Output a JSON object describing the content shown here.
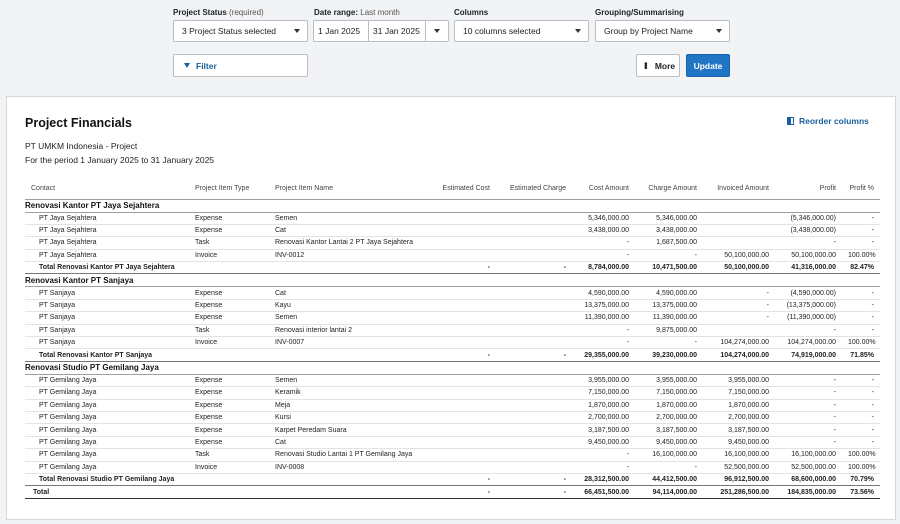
{
  "filters": {
    "status": {
      "label": "Project Status",
      "sub": "(required)",
      "value": "3 Project Status selected"
    },
    "date": {
      "label": "Date range:",
      "sub": "Last month",
      "from": "1 Jan 2025",
      "to": "31 Jan 2025"
    },
    "columns": {
      "label": "Columns",
      "value": "10 columns selected"
    },
    "grouping": {
      "label": "Grouping/Summarising",
      "value": "Group by Project Name"
    },
    "filter_label": "Filter",
    "more_label": "More",
    "update_label": "Update"
  },
  "report": {
    "title": "Project Financials",
    "org": "PT UMKM Indonesia - Project",
    "period": "For the period 1 January 2025 to 31 January 2025",
    "reorder_label": "Reorder columns",
    "headers": [
      "Contact",
      "Project Item Type",
      "Project Item Name",
      "Estimated Cost",
      "Estimated Charge",
      "Cost Amount",
      "Charge Amount",
      "Invoiced Amount",
      "Profit",
      "Profit %"
    ],
    "groups": [
      {
        "name": "Renovasi Kantor PT Jaya Sejahtera",
        "rows": [
          [
            "PT Jaya Sejahtera",
            "Expense",
            "Semen",
            "",
            "",
            "5,346,000.00",
            "5,346,000.00",
            "",
            "(5,346,000.00)",
            "-"
          ],
          [
            "PT Jaya Sejahtera",
            "Expense",
            "Cat",
            "",
            "",
            "3,438,000.00",
            "3,438,000.00",
            "",
            "(3,438,000.00)",
            "-"
          ],
          [
            "PT Jaya Sejahtera",
            "Task",
            "Renovasi Kantor Lantai 2 PT Jaya Sejahtera",
            "",
            "",
            "-",
            "1,687,500.00",
            "",
            "-",
            "-"
          ],
          [
            "PT Jaya Sejahtera",
            "Invoice",
            "INV-0012",
            "",
            "",
            "-",
            "-",
            "50,100,000.00",
            "50,100,000.00",
            "100.00%"
          ]
        ],
        "total": [
          "Total Renovasi Kantor PT Jaya Sejahtera",
          "",
          "",
          "-",
          "-",
          "8,784,000.00",
          "10,471,500.00",
          "50,100,000.00",
          "41,316,000.00",
          "82.47%"
        ]
      },
      {
        "name": "Renovasi Kantor PT Sanjaya",
        "rows": [
          [
            "PT Sanjaya",
            "Expense",
            "Cat",
            "",
            "",
            "4,590,000.00",
            "4,590,000.00",
            "-",
            "(4,590,000.00)",
            "-"
          ],
          [
            "PT Sanjaya",
            "Expense",
            "Kayu",
            "",
            "",
            "13,375,000.00",
            "13,375,000.00",
            "-",
            "(13,375,000.00)",
            "-"
          ],
          [
            "PT Sanjaya",
            "Expense",
            "Semen",
            "",
            "",
            "11,390,000.00",
            "11,390,000.00",
            "-",
            "(11,390,000.00)",
            "-"
          ],
          [
            "PT Sanjaya",
            "Task",
            "Renovasi interior lantai 2",
            "",
            "",
            "-",
            "9,875,000.00",
            "",
            "-",
            "-"
          ],
          [
            "PT Sanjaya",
            "Invoice",
            "INV-0007",
            "",
            "",
            "-",
            "-",
            "104,274,000.00",
            "104,274,000.00",
            "100.00%"
          ]
        ],
        "total": [
          "Total Renovasi Kantor PT Sanjaya",
          "",
          "",
          "-",
          "-",
          "29,355,000.00",
          "39,230,000.00",
          "104,274,000.00",
          "74,919,000.00",
          "71.85%"
        ]
      },
      {
        "name": "Renovasi Studio PT Gemilang Jaya",
        "rows": [
          [
            "PT Gemilang Jaya",
            "Expense",
            "Semen",
            "",
            "",
            "3,955,000.00",
            "3,955,000.00",
            "3,955,000.00",
            "-",
            "-"
          ],
          [
            "PT Gemilang Jaya",
            "Expense",
            "Keramik",
            "",
            "",
            "7,150,000.00",
            "7,150,000.00",
            "7,150,000.00",
            "-",
            "-"
          ],
          [
            "PT Gemilang Jaya",
            "Expense",
            "Meja",
            "",
            "",
            "1,870,000.00",
            "1,870,000.00",
            "1,870,000.00",
            "-",
            "-"
          ],
          [
            "PT Gemilang Jaya",
            "Expense",
            "Kursi",
            "",
            "",
            "2,700,000.00",
            "2,700,000.00",
            "2,700,000.00",
            "-",
            "-"
          ],
          [
            "PT Gemilang Jaya",
            "Expense",
            "Karpet Peredam Suara",
            "",
            "",
            "3,187,500.00",
            "3,187,500.00",
            "3,187,500.00",
            "-",
            "-"
          ],
          [
            "PT Gemilang Jaya",
            "Expense",
            "Cat",
            "",
            "",
            "9,450,000.00",
            "9,450,000.00",
            "9,450,000.00",
            "-",
            "-"
          ],
          [
            "PT Gemilang Jaya",
            "Task",
            "Renovasi Studio Lantai 1 PT Gemilang Jaya",
            "",
            "",
            "-",
            "16,100,000.00",
            "16,100,000.00",
            "16,100,000.00",
            "100.00%"
          ],
          [
            "PT Gemilang Jaya",
            "Invoice",
            "INV-0008",
            "",
            "",
            "-",
            "-",
            "52,500,000.00",
            "52,500,000.00",
            "100.00%"
          ]
        ],
        "total": [
          "Total Renovasi Studio PT Gemilang Jaya",
          "",
          "",
          "-",
          "-",
          "28,312,500.00",
          "44,412,500.00",
          "96,912,500.00",
          "68,600,000.00",
          "70.79%"
        ]
      }
    ],
    "grand_total": [
      "Total",
      "",
      "",
      "-",
      "-",
      "66,451,500.00",
      "94,114,000.00",
      "251,286,500.00",
      "184,835,000.00",
      "73.56%"
    ]
  }
}
